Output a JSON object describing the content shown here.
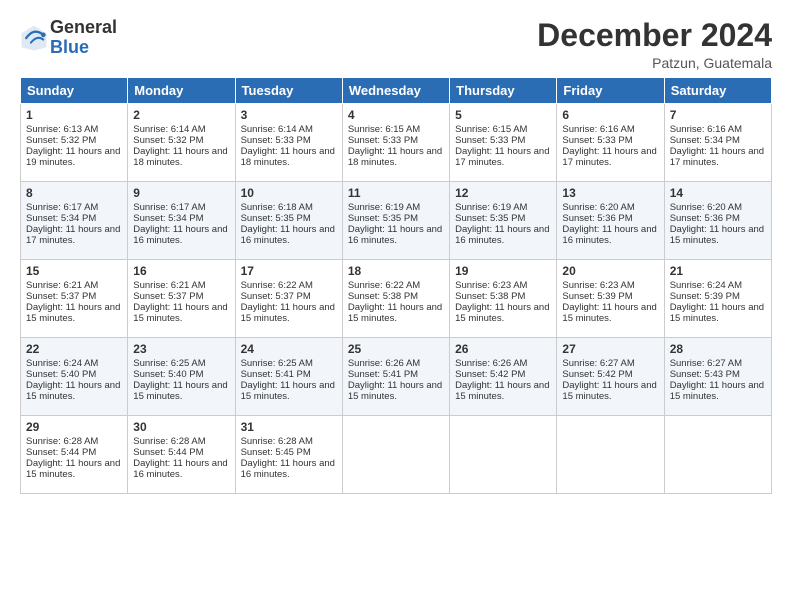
{
  "header": {
    "logo_general": "General",
    "logo_blue": "Blue",
    "month_title": "December 2024",
    "location": "Patzun, Guatemala"
  },
  "days_of_week": [
    "Sunday",
    "Monday",
    "Tuesday",
    "Wednesday",
    "Thursday",
    "Friday",
    "Saturday"
  ],
  "weeks": [
    [
      {
        "day": "1",
        "sunrise": "Sunrise: 6:13 AM",
        "sunset": "Sunset: 5:32 PM",
        "daylight": "Daylight: 11 hours and 19 minutes."
      },
      {
        "day": "2",
        "sunrise": "Sunrise: 6:14 AM",
        "sunset": "Sunset: 5:32 PM",
        "daylight": "Daylight: 11 hours and 18 minutes."
      },
      {
        "day": "3",
        "sunrise": "Sunrise: 6:14 AM",
        "sunset": "Sunset: 5:33 PM",
        "daylight": "Daylight: 11 hours and 18 minutes."
      },
      {
        "day": "4",
        "sunrise": "Sunrise: 6:15 AM",
        "sunset": "Sunset: 5:33 PM",
        "daylight": "Daylight: 11 hours and 18 minutes."
      },
      {
        "day": "5",
        "sunrise": "Sunrise: 6:15 AM",
        "sunset": "Sunset: 5:33 PM",
        "daylight": "Daylight: 11 hours and 17 minutes."
      },
      {
        "day": "6",
        "sunrise": "Sunrise: 6:16 AM",
        "sunset": "Sunset: 5:33 PM",
        "daylight": "Daylight: 11 hours and 17 minutes."
      },
      {
        "day": "7",
        "sunrise": "Sunrise: 6:16 AM",
        "sunset": "Sunset: 5:34 PM",
        "daylight": "Daylight: 11 hours and 17 minutes."
      }
    ],
    [
      {
        "day": "8",
        "sunrise": "Sunrise: 6:17 AM",
        "sunset": "Sunset: 5:34 PM",
        "daylight": "Daylight: 11 hours and 17 minutes."
      },
      {
        "day": "9",
        "sunrise": "Sunrise: 6:17 AM",
        "sunset": "Sunset: 5:34 PM",
        "daylight": "Daylight: 11 hours and 16 minutes."
      },
      {
        "day": "10",
        "sunrise": "Sunrise: 6:18 AM",
        "sunset": "Sunset: 5:35 PM",
        "daylight": "Daylight: 11 hours and 16 minutes."
      },
      {
        "day": "11",
        "sunrise": "Sunrise: 6:19 AM",
        "sunset": "Sunset: 5:35 PM",
        "daylight": "Daylight: 11 hours and 16 minutes."
      },
      {
        "day": "12",
        "sunrise": "Sunrise: 6:19 AM",
        "sunset": "Sunset: 5:35 PM",
        "daylight": "Daylight: 11 hours and 16 minutes."
      },
      {
        "day": "13",
        "sunrise": "Sunrise: 6:20 AM",
        "sunset": "Sunset: 5:36 PM",
        "daylight": "Daylight: 11 hours and 16 minutes."
      },
      {
        "day": "14",
        "sunrise": "Sunrise: 6:20 AM",
        "sunset": "Sunset: 5:36 PM",
        "daylight": "Daylight: 11 hours and 15 minutes."
      }
    ],
    [
      {
        "day": "15",
        "sunrise": "Sunrise: 6:21 AM",
        "sunset": "Sunset: 5:37 PM",
        "daylight": "Daylight: 11 hours and 15 minutes."
      },
      {
        "day": "16",
        "sunrise": "Sunrise: 6:21 AM",
        "sunset": "Sunset: 5:37 PM",
        "daylight": "Daylight: 11 hours and 15 minutes."
      },
      {
        "day": "17",
        "sunrise": "Sunrise: 6:22 AM",
        "sunset": "Sunset: 5:37 PM",
        "daylight": "Daylight: 11 hours and 15 minutes."
      },
      {
        "day": "18",
        "sunrise": "Sunrise: 6:22 AM",
        "sunset": "Sunset: 5:38 PM",
        "daylight": "Daylight: 11 hours and 15 minutes."
      },
      {
        "day": "19",
        "sunrise": "Sunrise: 6:23 AM",
        "sunset": "Sunset: 5:38 PM",
        "daylight": "Daylight: 11 hours and 15 minutes."
      },
      {
        "day": "20",
        "sunrise": "Sunrise: 6:23 AM",
        "sunset": "Sunset: 5:39 PM",
        "daylight": "Daylight: 11 hours and 15 minutes."
      },
      {
        "day": "21",
        "sunrise": "Sunrise: 6:24 AM",
        "sunset": "Sunset: 5:39 PM",
        "daylight": "Daylight: 11 hours and 15 minutes."
      }
    ],
    [
      {
        "day": "22",
        "sunrise": "Sunrise: 6:24 AM",
        "sunset": "Sunset: 5:40 PM",
        "daylight": "Daylight: 11 hours and 15 minutes."
      },
      {
        "day": "23",
        "sunrise": "Sunrise: 6:25 AM",
        "sunset": "Sunset: 5:40 PM",
        "daylight": "Daylight: 11 hours and 15 minutes."
      },
      {
        "day": "24",
        "sunrise": "Sunrise: 6:25 AM",
        "sunset": "Sunset: 5:41 PM",
        "daylight": "Daylight: 11 hours and 15 minutes."
      },
      {
        "day": "25",
        "sunrise": "Sunrise: 6:26 AM",
        "sunset": "Sunset: 5:41 PM",
        "daylight": "Daylight: 11 hours and 15 minutes."
      },
      {
        "day": "26",
        "sunrise": "Sunrise: 6:26 AM",
        "sunset": "Sunset: 5:42 PM",
        "daylight": "Daylight: 11 hours and 15 minutes."
      },
      {
        "day": "27",
        "sunrise": "Sunrise: 6:27 AM",
        "sunset": "Sunset: 5:42 PM",
        "daylight": "Daylight: 11 hours and 15 minutes."
      },
      {
        "day": "28",
        "sunrise": "Sunrise: 6:27 AM",
        "sunset": "Sunset: 5:43 PM",
        "daylight": "Daylight: 11 hours and 15 minutes."
      }
    ],
    [
      {
        "day": "29",
        "sunrise": "Sunrise: 6:28 AM",
        "sunset": "Sunset: 5:44 PM",
        "daylight": "Daylight: 11 hours and 15 minutes."
      },
      {
        "day": "30",
        "sunrise": "Sunrise: 6:28 AM",
        "sunset": "Sunset: 5:44 PM",
        "daylight": "Daylight: 11 hours and 16 minutes."
      },
      {
        "day": "31",
        "sunrise": "Sunrise: 6:28 AM",
        "sunset": "Sunset: 5:45 PM",
        "daylight": "Daylight: 11 hours and 16 minutes."
      },
      null,
      null,
      null,
      null
    ]
  ]
}
